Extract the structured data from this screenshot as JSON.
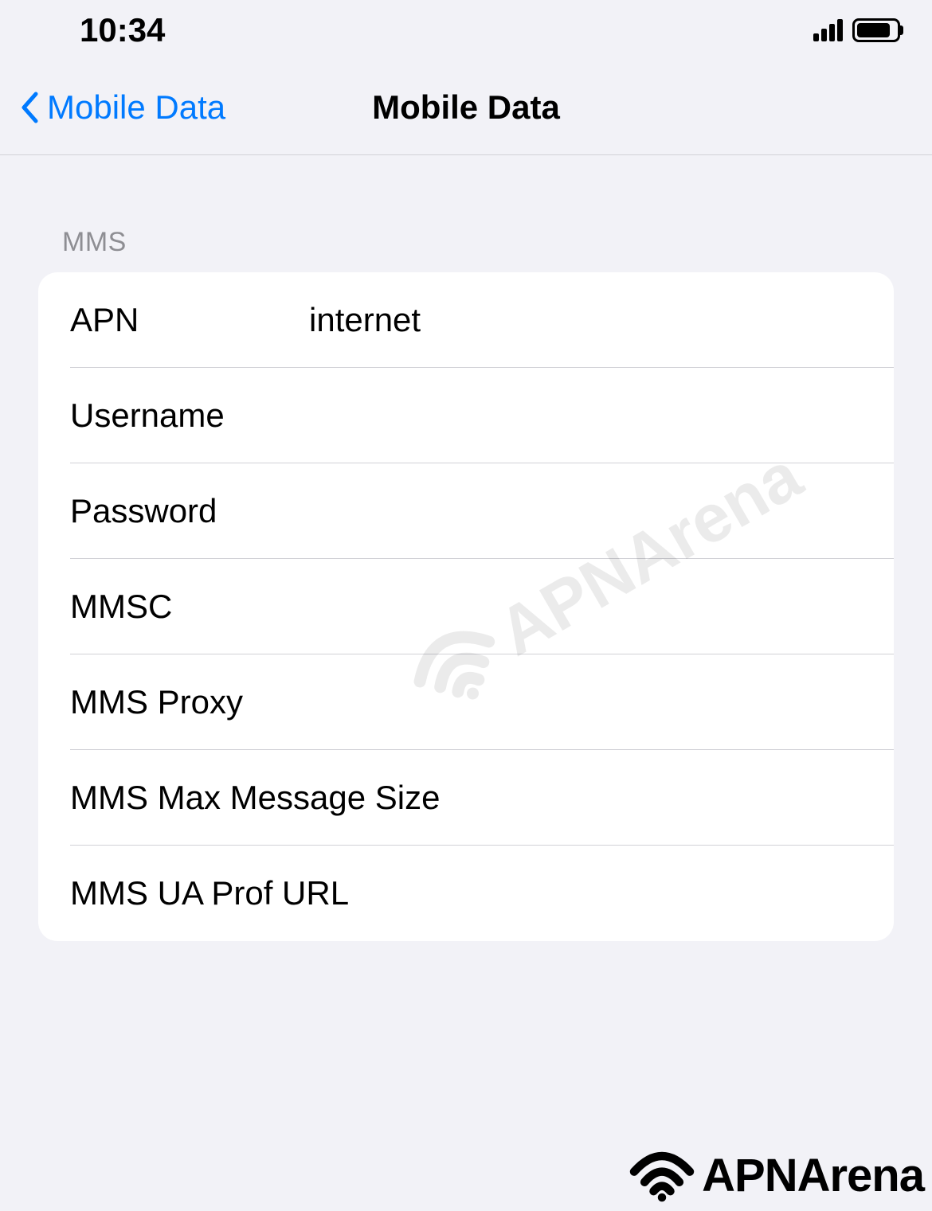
{
  "statusBar": {
    "time": "10:34"
  },
  "nav": {
    "backLabel": "Mobile Data",
    "title": "Mobile Data"
  },
  "section": {
    "header": "MMS",
    "rows": {
      "apn": {
        "label": "APN",
        "value": "internet"
      },
      "username": {
        "label": "Username",
        "value": ""
      },
      "password": {
        "label": "Password",
        "value": ""
      },
      "mmsc": {
        "label": "MMSC",
        "value": ""
      },
      "mmsProxy": {
        "label": "MMS Proxy",
        "value": ""
      },
      "mmsMaxSize": {
        "label": "MMS Max Message Size",
        "value": ""
      },
      "mmsUaProf": {
        "label": "MMS UA Prof URL",
        "value": ""
      }
    }
  },
  "watermark": {
    "text": "APNArena"
  },
  "footer": {
    "brand": "APNArena"
  }
}
